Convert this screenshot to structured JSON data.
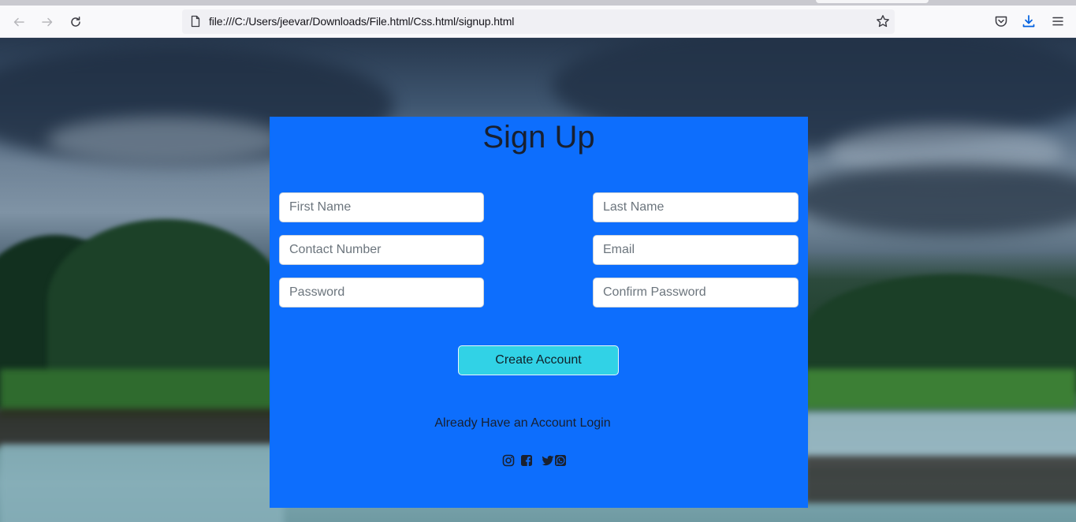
{
  "browser": {
    "url": "file:///C:/Users/jeevar/Downloads/File.html/Css.html/signup.html",
    "icons": {
      "back": "arrow-left-icon",
      "forward": "arrow-right-icon",
      "reload": "reload-icon",
      "page": "page-icon",
      "bookmark": "star-icon",
      "pocket": "pocket-icon",
      "downloads": "download-icon",
      "menu": "hamburger-menu-icon"
    }
  },
  "signup": {
    "title": "Sign Up",
    "fields": {
      "first_name": "First Name",
      "last_name": "Last Name",
      "contact_number": "Contact Number",
      "email": "Email",
      "password": "Password",
      "confirm_password": "Confirm Password"
    },
    "create_button": "Create Account",
    "login_text": "Already Have an Account Login",
    "social": [
      "instagram-icon",
      "facebook-icon",
      "twitter-icon",
      "whatsapp-icon"
    ]
  },
  "colors": {
    "card": "#0d6efd",
    "button": "#31d2e6",
    "download_accent": "#0061e0"
  }
}
